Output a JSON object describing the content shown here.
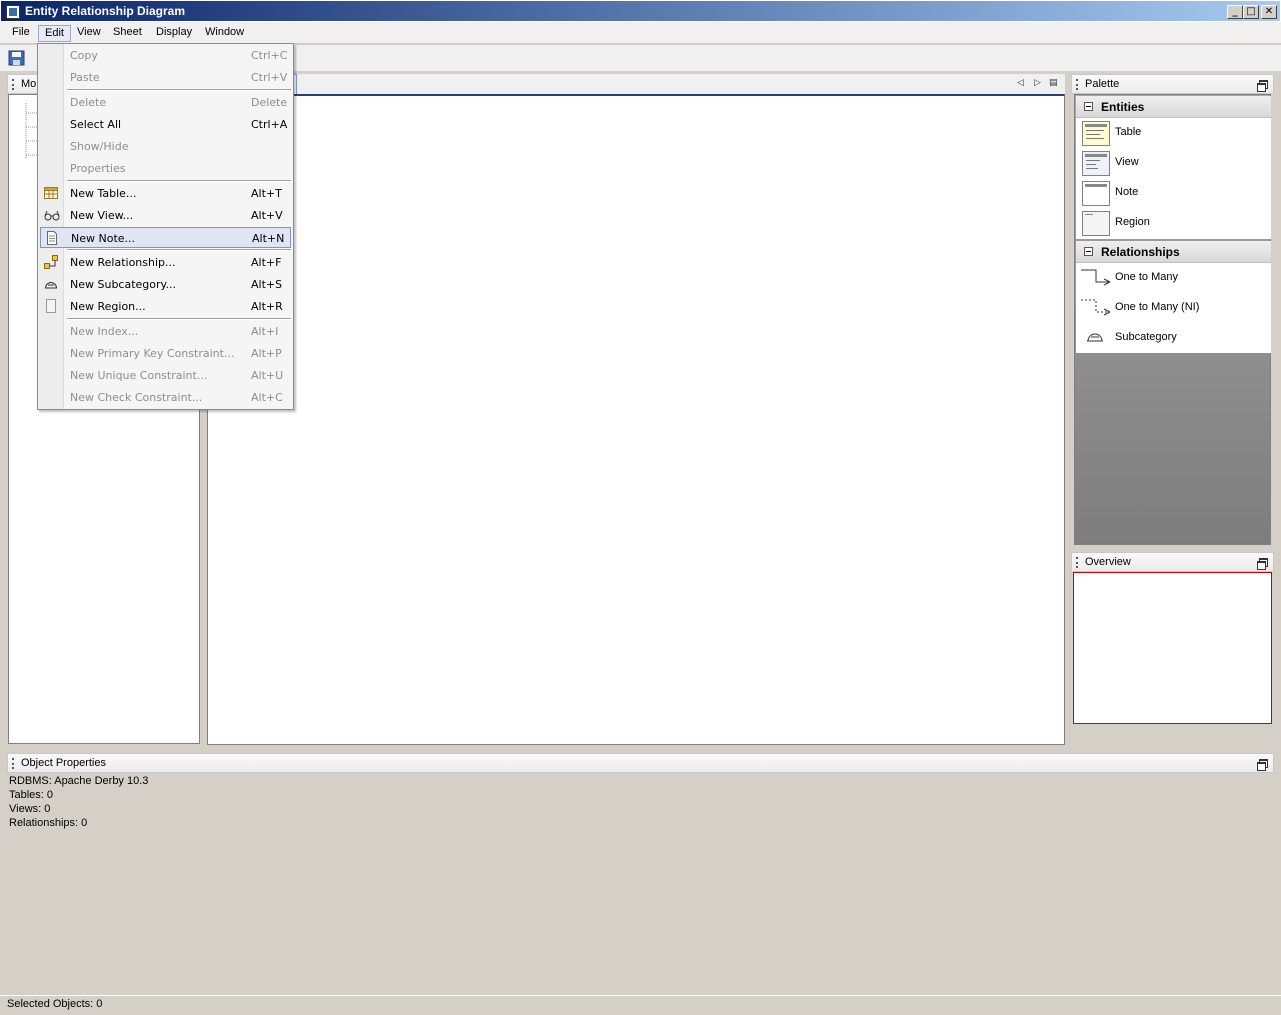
{
  "window": {
    "title": "Entity Relationship Diagram",
    "minimize": "_",
    "maximize": "□",
    "close": "✕"
  },
  "menubar": [
    "File",
    "Edit",
    "View",
    "Sheet",
    "Display",
    "Window"
  ],
  "model_panel": {
    "title": "Mo"
  },
  "sheet": {
    "nav_prev": "◁",
    "nav_next": "▷",
    "nav_list": "▤"
  },
  "palette": {
    "title": "Palette",
    "groups": [
      {
        "name": "Entities",
        "items": [
          "Table",
          "View",
          "Note",
          "Region"
        ]
      },
      {
        "name": "Relationships",
        "items": [
          "One to Many",
          "One to Many (NI)",
          "Subcategory"
        ]
      }
    ]
  },
  "overview": {
    "title": "Overview"
  },
  "object_properties": {
    "title": "Object Properties",
    "rows": [
      "RDBMS: Apache Derby 10.3",
      "Tables: 0",
      "Views: 0",
      "Relationships: 0"
    ]
  },
  "status": {
    "text": "Selected Objects: 0"
  },
  "edit_menu": {
    "items": [
      {
        "label": "Copy",
        "shortcut": "Ctrl+C",
        "enabled": false
      },
      {
        "label": "Paste",
        "shortcut": "Ctrl+V",
        "enabled": false
      },
      {
        "label": "Delete",
        "shortcut": "Delete",
        "enabled": false
      },
      {
        "label": "Select All",
        "shortcut": "Ctrl+A",
        "enabled": true
      },
      {
        "label": "Show/Hide",
        "shortcut": "",
        "enabled": false
      },
      {
        "label": "Properties",
        "shortcut": "",
        "enabled": false
      },
      {
        "label": "New Table...",
        "shortcut": "Alt+T",
        "enabled": true,
        "icon": "table-icon"
      },
      {
        "label": "New View...",
        "shortcut": "Alt+V",
        "enabled": true,
        "icon": "glasses-icon"
      },
      {
        "label": "New Note...",
        "shortcut": "Alt+N",
        "enabled": true,
        "icon": "note-icon",
        "highlighted": true
      },
      {
        "label": "New Relationship...",
        "shortcut": "Alt+F",
        "enabled": true,
        "icon": "relationship-icon"
      },
      {
        "label": "New Subcategory...",
        "shortcut": "Alt+S",
        "enabled": true,
        "icon": "subcategory-icon"
      },
      {
        "label": "New Region...",
        "shortcut": "Alt+R",
        "enabled": true,
        "icon": "region-icon"
      },
      {
        "label": "New Index...",
        "shortcut": "Alt+I",
        "enabled": false
      },
      {
        "label": "New Primary Key Constraint...",
        "shortcut": "Alt+P",
        "enabled": false
      },
      {
        "label": "New Unique Constraint...",
        "shortcut": "Alt+U",
        "enabled": false
      },
      {
        "label": "New Check Constraint...",
        "shortcut": "Alt+C",
        "enabled": false
      }
    ]
  }
}
